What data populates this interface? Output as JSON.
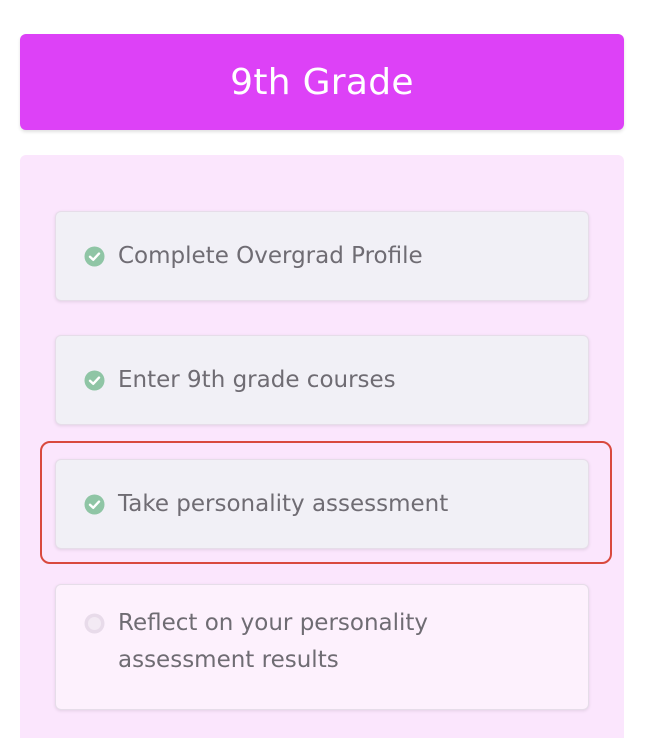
{
  "header": {
    "title": "9th Grade",
    "color": "#dd41f7"
  },
  "panel": {
    "background": "#fbe6fd"
  },
  "tasks": [
    {
      "label": "Complete Overgrad Profile",
      "status": "complete",
      "icon": "check-circle-icon"
    },
    {
      "label": "Enter 9th grade courses",
      "status": "complete",
      "icon": "check-circle-icon"
    },
    {
      "label": "Take personality assessment",
      "status": "complete",
      "icon": "check-circle-icon",
      "highlighted": true
    },
    {
      "label": "Reflect on your personality assessment results",
      "status": "incomplete",
      "icon": "empty-circle-icon"
    }
  ],
  "colors": {
    "check": "#8fc5a5",
    "incomplete_circle": "#e8dbea",
    "highlight_border": "#d9493e"
  }
}
